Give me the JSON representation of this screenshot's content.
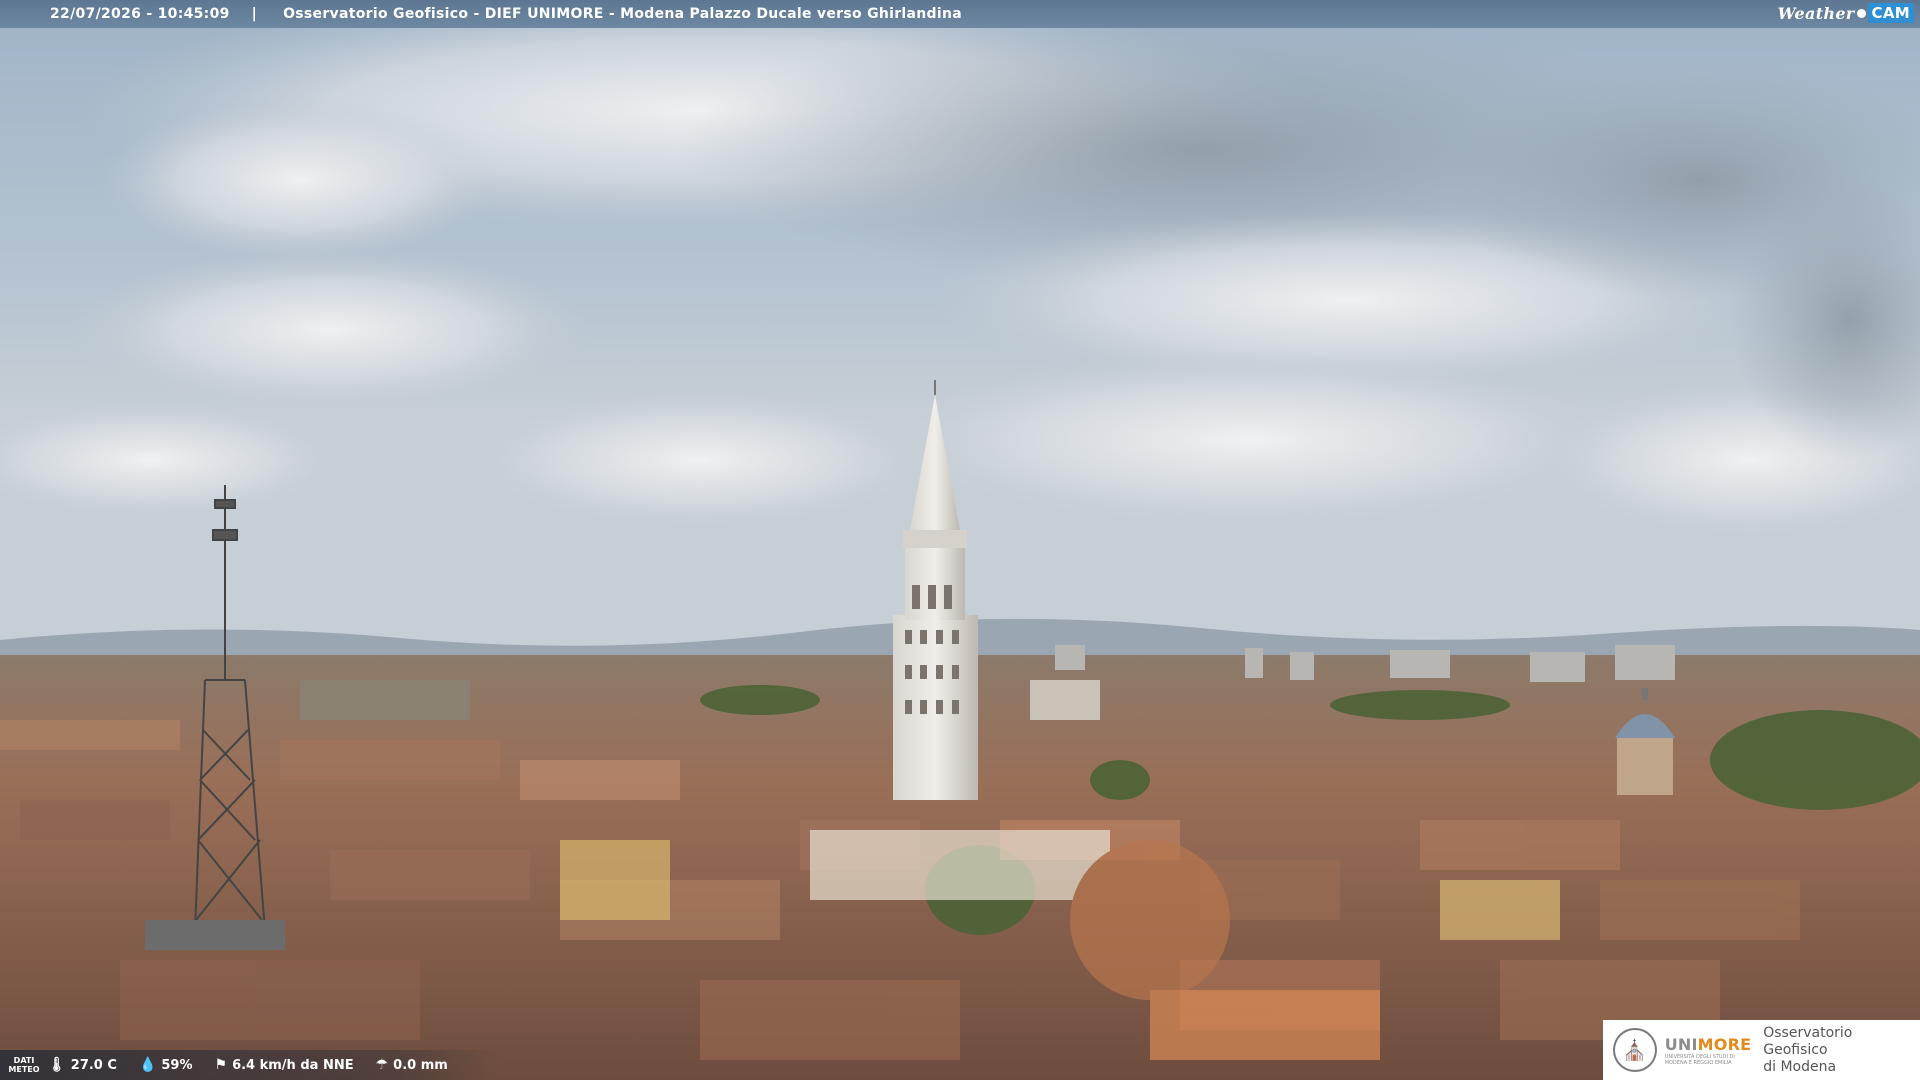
{
  "header": {
    "timestamp": "22/07/2026 - 10:45:09",
    "separator": "|",
    "title": "Osservatorio Geofisico - DIEF UNIMORE - Modena Palazzo Ducale verso Ghirlandina",
    "brand_weather": "Weather",
    "brand_cam": "CAM"
  },
  "weather_data": {
    "label_line1": "DATI",
    "label_line2": "METEO",
    "temperature": "27.0 C",
    "temperature_icon": "thermometer-icon",
    "humidity": "59%",
    "humidity_icon": "drop-icon",
    "wind": "6.4 km/h da NNE",
    "wind_icon": "windsock-icon",
    "rain": "0.0 mm",
    "rain_icon": "umbrella-icon"
  },
  "logo": {
    "university_prefix": "UNI",
    "university_accent": "MORE",
    "university_subtitle": "UNIVERSITÀ DEGLI STUDI DI MODENA E REGGIO EMILIA",
    "observatory_line1": "Osservatorio Geofisico",
    "observatory_line2": "di Modena",
    "accent_color": "#e28a1c"
  },
  "colors": {
    "topbar": "#6e88a3",
    "sky": "#8ea7bf",
    "roofs": "#a0705a",
    "tower": "#e6e2dc"
  }
}
